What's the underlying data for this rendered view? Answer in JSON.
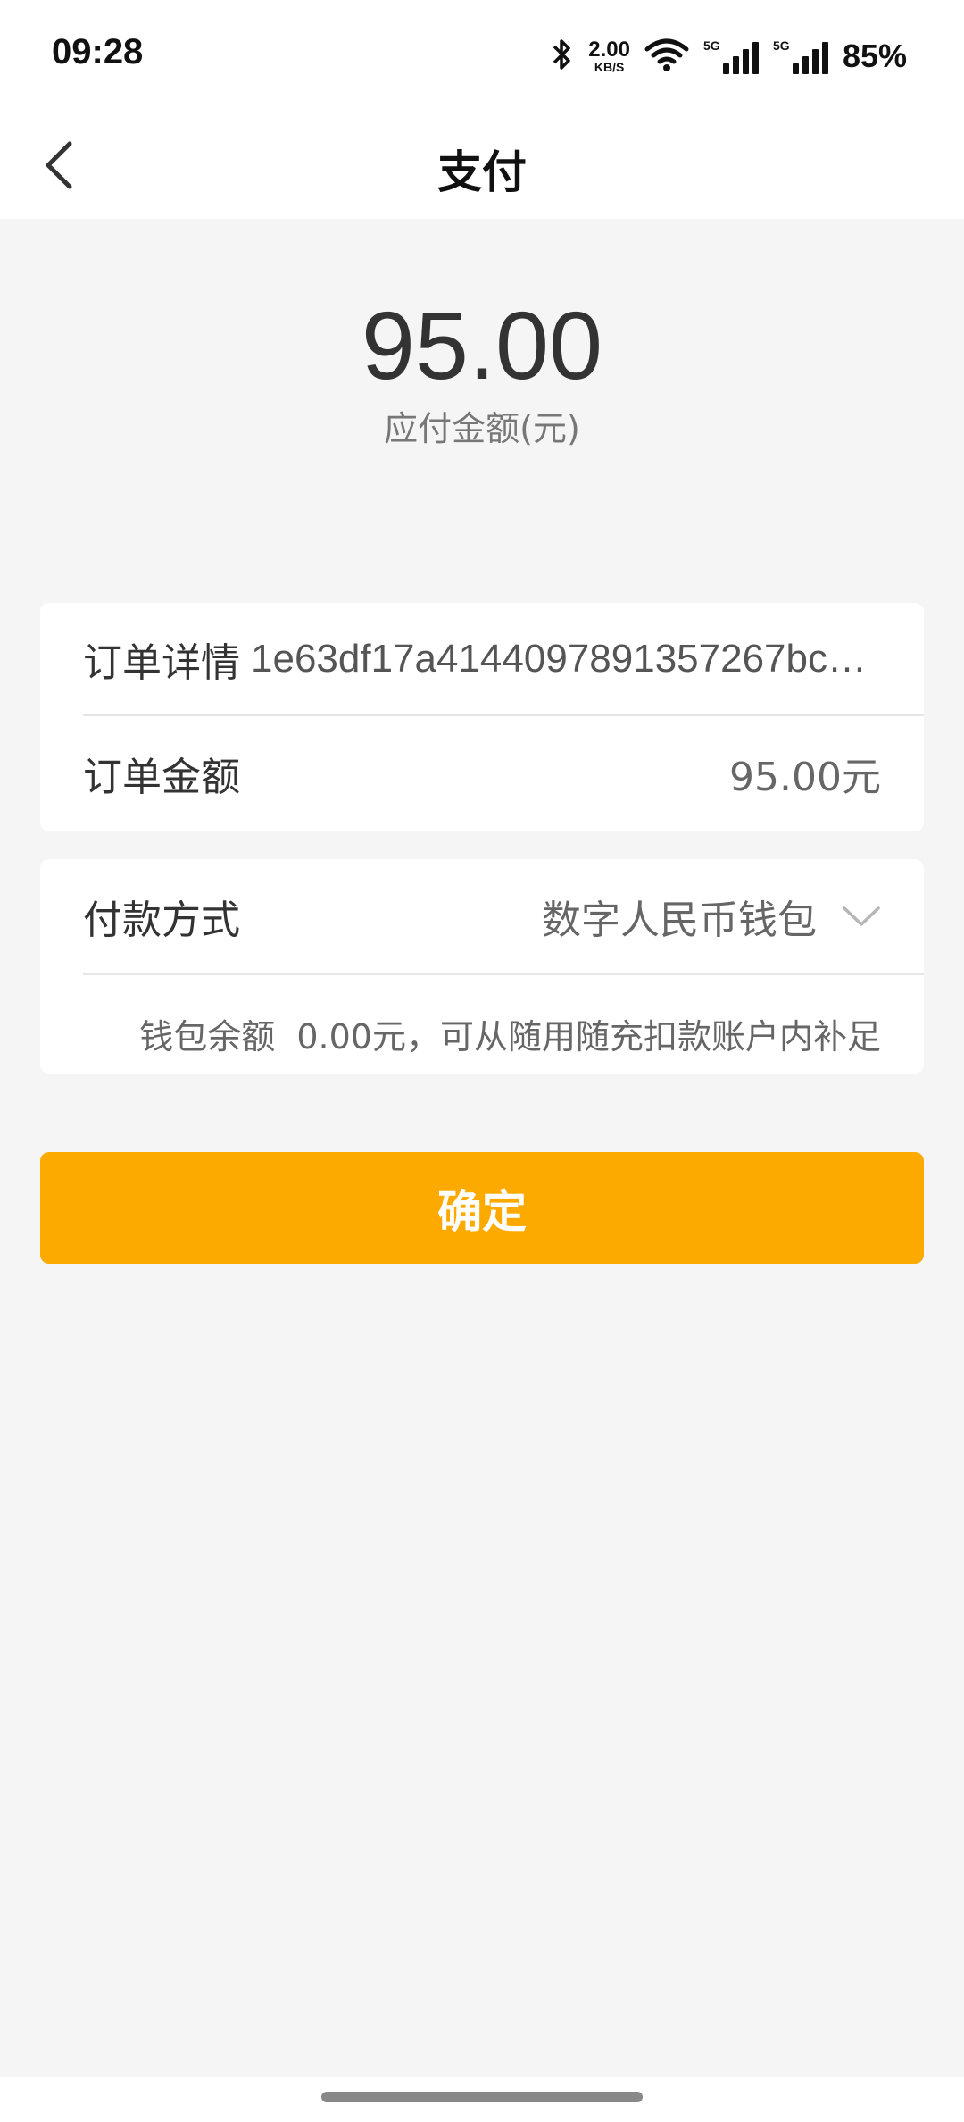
{
  "status_bar": {
    "time": "09:28",
    "net_speed_value": "2.00",
    "net_speed_unit": "KB/S",
    "signal1_tag": "5G",
    "signal2_tag": "5G",
    "battery": "85%"
  },
  "nav": {
    "title": "支付"
  },
  "amount": {
    "value": "95.00",
    "label": "应付金额(元)"
  },
  "order": {
    "detail_label": "订单详情",
    "detail_value": "1e63df17a4144097891357267bc…",
    "amount_label": "订单金额",
    "amount_value": "95.00元"
  },
  "payment": {
    "method_label": "付款方式",
    "method_value": "数字人民币钱包",
    "balance_text": "钱包余额  0.00元，可从随用随充扣款账户内补足"
  },
  "confirm_label": "确定",
  "colors": {
    "accent": "#fdaa00",
    "background": "#f5f5f5",
    "card": "#ffffff"
  }
}
